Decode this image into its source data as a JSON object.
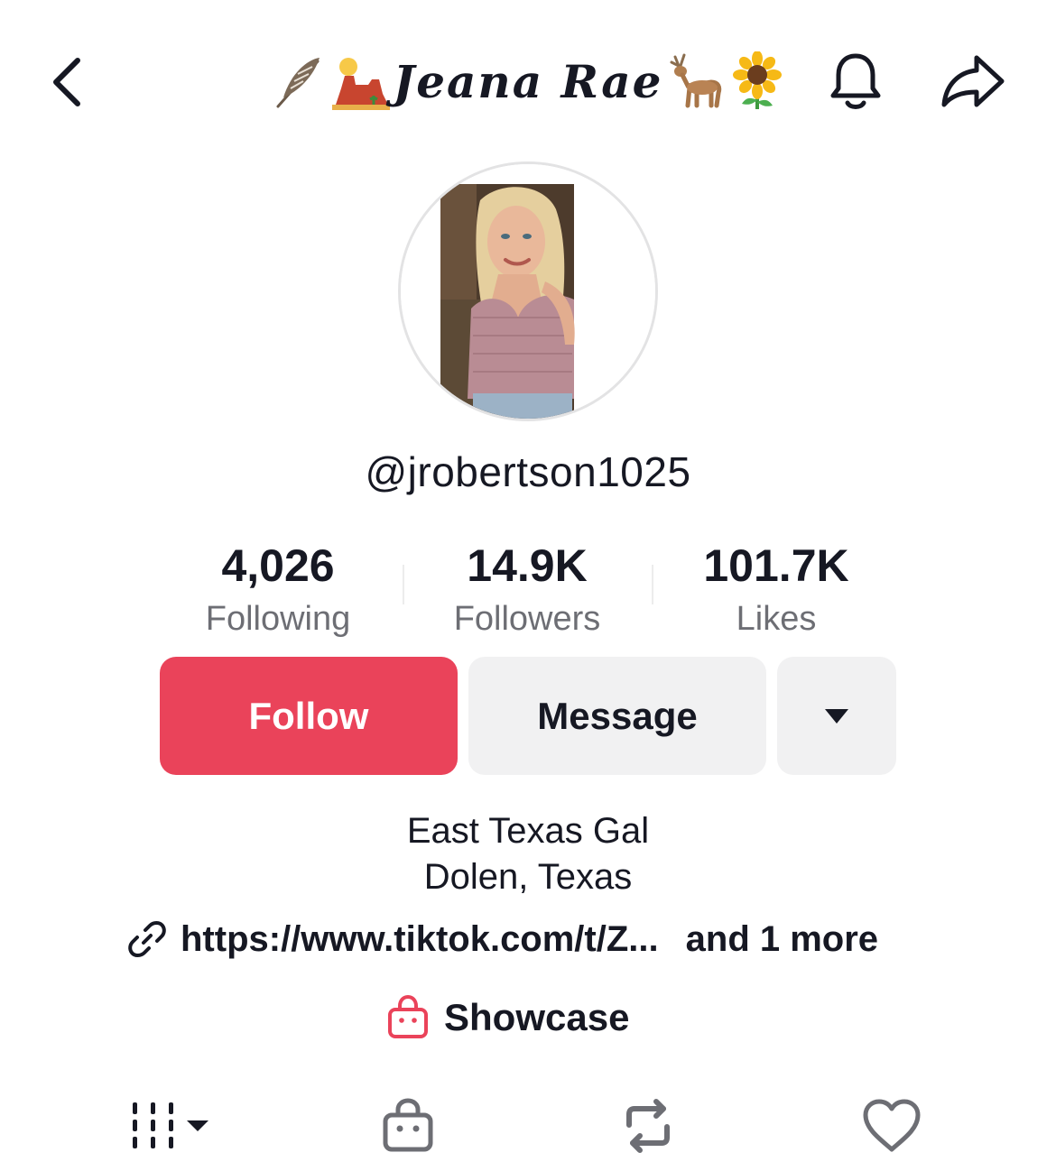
{
  "header": {
    "title": "Jeana Rae",
    "title_emojis_left": [
      "feather-icon",
      "desert-mesa-icon"
    ],
    "title_emojis_right": [
      "deer-icon",
      "sunflower-icon"
    ],
    "back_icon": "chevron-left-icon",
    "bell_icon": "bell-icon",
    "share_icon": "share-arrow-icon"
  },
  "profile": {
    "username": "@jrobertson1025",
    "stats": [
      {
        "value": "4,026",
        "label": "Following"
      },
      {
        "value": "14.9K",
        "label": "Followers"
      },
      {
        "value": "101.7K",
        "label": "Likes"
      }
    ]
  },
  "actions": {
    "follow_label": "Follow",
    "message_label": "Message",
    "more_icon": "triangle-down-icon"
  },
  "bio": {
    "lines": [
      "East Texas Gal",
      "Dolen, Texas"
    ],
    "link_text": "https://www.tiktok.com/t/Z...",
    "link_more": "and 1 more",
    "showcase_label": "Showcase"
  },
  "tabs": [
    {
      "name": "videos-grid-icon"
    },
    {
      "name": "shop-bag-icon"
    },
    {
      "name": "repost-icon"
    },
    {
      "name": "heart-icon"
    }
  ],
  "colors": {
    "follow": "#ea435a",
    "secondary_button": "#f1f1f2",
    "text": "#161823",
    "muted": "#6d6e74"
  }
}
